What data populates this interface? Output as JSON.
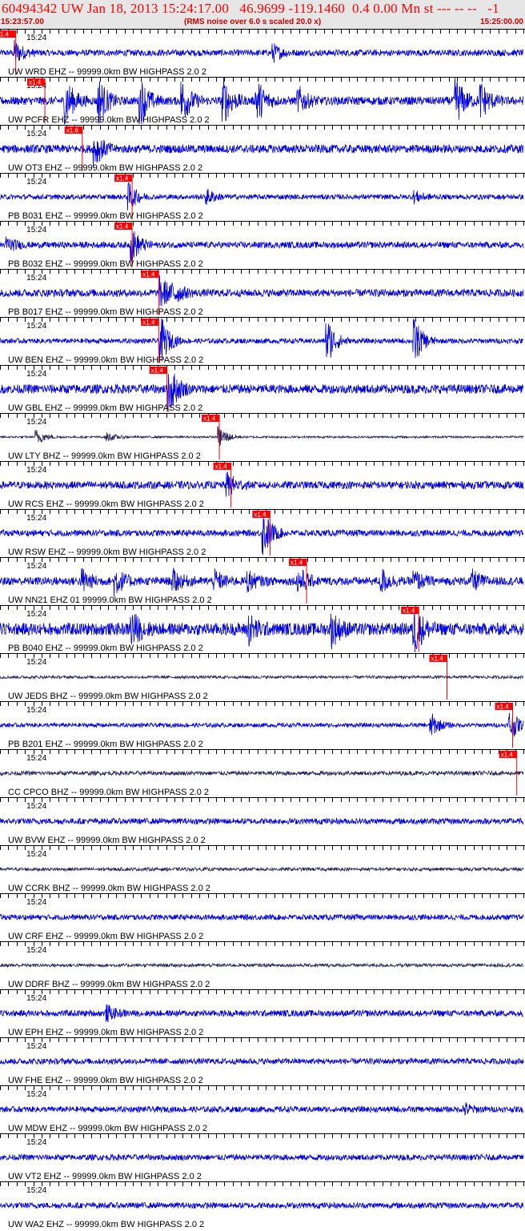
{
  "header": {
    "title": "60494342 UW Jan 18, 2013 15:24:17.00   46.9699 -119.1460  0.4 0.00 Mn st --- -- --   -1",
    "start_time": "15:23:57.00",
    "rms_note": "(RMS noise over 6.0 s scaled 20.0 x)",
    "end_time": "15:25:00.00"
  },
  "colors": {
    "header_bg": "#e6e6e6",
    "header_text": "#ff0000",
    "trace": "#0000dd",
    "trace_dark": "#22205a",
    "pick": "#ff0000",
    "separator": "#000000"
  },
  "chart_data": {
    "type": "line",
    "title": "60494342 UW Jan 18, 2013 15:24:17.00   46.9699 -119.1460  0.4 0.00 Mn st --- -- --   -1",
    "x_start": "15:23:57.00",
    "x_end": "15:25:00.00",
    "x_unit": "seconds after 15:23:57.00",
    "xlim": [
      0,
      63
    ],
    "tick_interval_s": 1,
    "time_label": "15:24",
    "time_label_s": 3,
    "traces": [
      {
        "label": "UW WRD EHZ -- 99999.0km BW  HIGHPASS  2.0  2",
        "pick_s": 1.9,
        "pick_label": "1.4",
        "amplitude": 0.15,
        "color": "#0000dd",
        "bursts": [
          [
            1.9,
            0.5
          ],
          [
            33,
            0.35
          ]
        ]
      },
      {
        "label": "UW PCFR EHZ -- 99999.0km BW  HIGHPASS  2.0  2",
        "pick_s": 5.4,
        "pick_label": "x1.4",
        "amplitude": 0.2,
        "color": "#0000dd",
        "bursts": [
          [
            8,
            1
          ],
          [
            12,
            1
          ],
          [
            17,
            1
          ],
          [
            22,
            1
          ],
          [
            27,
            1
          ],
          [
            31,
            1
          ],
          [
            36,
            0.6
          ],
          [
            55,
            1
          ],
          [
            58,
            0.8
          ]
        ]
      },
      {
        "label": "UW OT3 EHZ -- 99999.0km BW  HIGHPASS  2.0  2",
        "pick_s": 9.9,
        "pick_label": "x1.6",
        "amplitude": 0.2,
        "color": "#0000dd",
        "bursts": [
          [
            11.5,
            0.7
          ]
        ]
      },
      {
        "label": "PB B031 EHZ -- 99999.0km BW  HIGHPASS  2.0  2",
        "pick_s": 15.9,
        "pick_label": "x1.4",
        "amplitude": 0.12,
        "color": "#0000dd",
        "bursts": [
          [
            15.6,
            0.6
          ],
          [
            25,
            0.3
          ],
          [
            50,
            0.25
          ]
        ]
      },
      {
        "label": "PB B032 EHZ -- 99999.0km BW  HIGHPASS  2.0  2",
        "pick_s": 15.9,
        "pick_label": "x1.4",
        "amplitude": 0.15,
        "color": "#0000dd",
        "bursts": [
          [
            16,
            0.7
          ],
          [
            1,
            0.3
          ]
        ]
      },
      {
        "label": "PB B017 EHZ -- 99999.0km BW  HIGHPASS  2.0  2",
        "pick_s": 19.1,
        "pick_label": "x1.4",
        "amplitude": 0.18,
        "color": "#0000dd",
        "bursts": [
          [
            19.5,
            0.7
          ],
          [
            21,
            0.5
          ]
        ]
      },
      {
        "label": "UW BEN EHZ -- 99999.0km BW  HIGHPASS  2.0  2",
        "pick_s": 19.1,
        "pick_label": "x1.4",
        "amplitude": 0.12,
        "color": "#0000dd",
        "bursts": [
          [
            19.5,
            1
          ],
          [
            39.5,
            1
          ],
          [
            50,
            1
          ]
        ]
      },
      {
        "label": "UW GBL EHZ -- 99999.0km BW  HIGHPASS  2.0  2",
        "pick_s": 20.1,
        "pick_label": "x1.4",
        "amplitude": 0.22,
        "color": "#0000dd",
        "bursts": [
          [
            20.5,
            1
          ]
        ]
      },
      {
        "label": "UW LTY BHZ -- 99999.0km BW  HIGHPASS  2.0  2",
        "pick_s": 26.4,
        "pick_label": "x1.4",
        "amplitude": 0.05,
        "color": "#22205a",
        "bursts": [
          [
            4.5,
            0.35
          ],
          [
            13,
            0.2
          ],
          [
            26.5,
            0.5
          ]
        ]
      },
      {
        "label": "UW RCS EHZ -- 99999.0km BW  HIGHPASS  2.0  2",
        "pick_s": 27.8,
        "pick_label": "x1.4",
        "amplitude": 0.18,
        "color": "#0000dd",
        "bursts": [
          [
            27.5,
            0.5
          ]
        ]
      },
      {
        "label": "UW RSW EHZ -- 99999.0km BW  HIGHPASS  2.0  2",
        "pick_s": 32.5,
        "pick_label": "x1.4",
        "amplitude": 0.15,
        "color": "#0000dd",
        "bursts": [
          [
            31.8,
            1
          ]
        ]
      },
      {
        "label": "UW NN21 EHZ 01 99999.0km BW  HIGHPASS  2.0  2",
        "pick_s": 36.9,
        "pick_label": "x1.4",
        "amplitude": 0.2,
        "color": "#0000dd",
        "bursts": [
          [
            10,
            0.5
          ],
          [
            14,
            0.6
          ],
          [
            21,
            0.45
          ],
          [
            26,
            0.4
          ],
          [
            30,
            0.4
          ],
          [
            36,
            0.6
          ],
          [
            46,
            0.5
          ],
          [
            50,
            0.4
          ],
          [
            57,
            0.4
          ]
        ]
      },
      {
        "label": "PB B040 EHZ -- 99999.0km BW  HIGHPASS  2.0  2",
        "pick_s": 50.4,
        "pick_label": "x1.4",
        "amplitude": 0.3,
        "color": "#0000dd",
        "bursts": [
          [
            16,
            0.7
          ],
          [
            30,
            0.6
          ],
          [
            40,
            0.7
          ],
          [
            50,
            1
          ]
        ]
      },
      {
        "label": "UW JEDS BHZ -- 99999.0km BW  HIGHPASS  2.0  2",
        "pick_s": 53.8,
        "pick_label": "x1.4",
        "amplitude": 0.07,
        "color": "#22205a",
        "bursts": []
      },
      {
        "label": "PB B201 EHZ -- 99999.0km BW  HIGHPASS  2.0  2",
        "pick_s": 61.7,
        "pick_label": "x1.4",
        "amplitude": 0.1,
        "color": "#0000dd",
        "bursts": [
          [
            52,
            0.5
          ],
          [
            61.5,
            0.7
          ]
        ]
      },
      {
        "label": "CC CPCO BHZ -- 99999.0km BW  HIGHPASS  2.0  2",
        "pick_s": 62.2,
        "pick_label": "x1.4",
        "amplitude": 0.1,
        "color": "#22205a",
        "bursts": []
      },
      {
        "label": "UW BVW EHZ -- 99999.0km BW  HIGHPASS  2.0  2",
        "amplitude": 0.14,
        "color": "#0000dd",
        "bursts": []
      },
      {
        "label": "UW CCRK BHZ -- 99999.0km BW  HIGHPASS  2.0  2",
        "amplitude": 0.08,
        "color": "#22205a",
        "bursts": []
      },
      {
        "label": "UW CRF EHZ -- 99999.0km BW  HIGHPASS  2.0  2",
        "amplitude": 0.13,
        "color": "#0000dd",
        "bursts": []
      },
      {
        "label": "UW DDRF BHZ -- 99999.0km BW  HIGHPASS  2.0  2",
        "amplitude": 0.08,
        "color": "#22205a",
        "bursts": []
      },
      {
        "label": "UW EPH EHZ -- 99999.0km BW  HIGHPASS  2.0  2",
        "amplitude": 0.15,
        "color": "#0000dd",
        "bursts": [
          [
            13,
            0.3
          ]
        ]
      },
      {
        "label": "UW FHE EHZ -- 99999.0km BW  HIGHPASS  2.0  2",
        "amplitude": 0.14,
        "color": "#0000dd",
        "bursts": []
      },
      {
        "label": "UW MDW EHZ -- 99999.0km BW  HIGHPASS  2.0  2",
        "amplitude": 0.14,
        "color": "#0000dd",
        "bursts": [
          [
            56,
            0.25
          ]
        ]
      },
      {
        "label": "UW VT2 EHZ -- 99999.0km BW  HIGHPASS  2.0  2",
        "amplitude": 0.14,
        "color": "#0000dd",
        "bursts": []
      },
      {
        "label": "UW WA2 EHZ -- 99999.0km BW  HIGHPASS  2.0  2",
        "amplitude": 0.14,
        "color": "#0000dd",
        "bursts": []
      }
    ]
  }
}
